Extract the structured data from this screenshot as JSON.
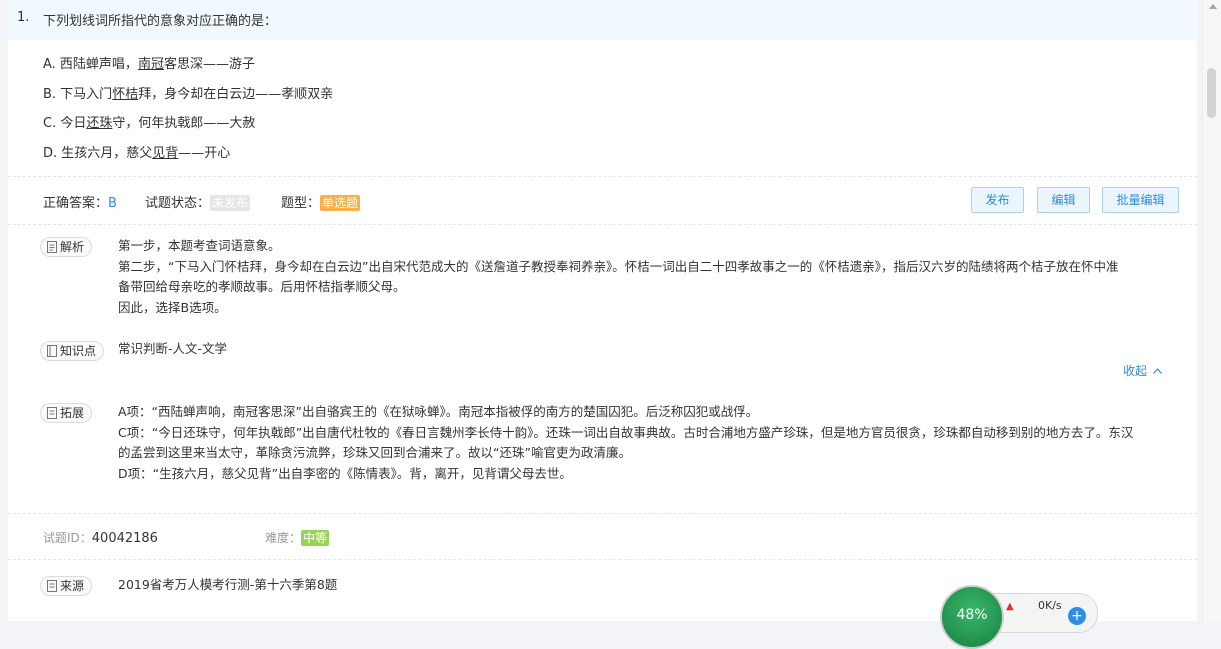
{
  "question": {
    "number": "1.",
    "title": "下列划线词所指代的意象对应正确的是：",
    "options": [
      {
        "prefix": "A.  西陆蝉声唱，",
        "underline": "南冠",
        "suffix": "客思深——游子"
      },
      {
        "prefix": "B.  下马入门",
        "underline": "怀桔",
        "suffix": "拜，身今却在白云边——孝顺双亲"
      },
      {
        "prefix": "C.  今日",
        "underline": "还珠",
        "suffix": "守，何年执戟郎——大赦"
      },
      {
        "prefix": "D.  生孩六月，慈父",
        "underline": "见背",
        "suffix": "——开心"
      }
    ]
  },
  "meta": {
    "answer_label": "正确答案：",
    "answer_value": "B",
    "status_label": "试题状态：",
    "status_value": "未发布",
    "type_label": "题型：",
    "type_value": "单选题"
  },
  "buttons": {
    "publish": "发布",
    "edit": "编辑",
    "batch_edit": "批量编辑"
  },
  "analysis": {
    "label": "解析",
    "lines": [
      "第一步，本题考查词语意象。",
      "第二步，“下马入门怀桔拜，身今却在白云边”出自宋代范成大的《送詹道子教授奉祠养亲》。怀桔一词出自二十四孝故事之一的《怀桔遗亲》，指后汉六岁的陆绩将两个桔子放在怀中准",
      "备带回给母亲吃的孝顺故事。后用怀桔指孝顺父母。",
      "因此，选择B选项。"
    ]
  },
  "knowledge": {
    "label": "知识点",
    "value": "常识判断-人文-文学"
  },
  "collapse_label": "收起",
  "extension": {
    "label": "拓展",
    "lines": [
      "A项：“西陆蝉声响，南冠客思深”出自骆宾王的《在狱咏蝉》。南冠本指被俘的南方的楚国囚犯。后泛称囚犯或战俘。",
      "C项：“今日还珠守，何年执戟郎”出自唐代杜牧的《春日言魏州李长侍十韵》。还珠一词出自故事典故。古时合浦地方盛产珍珠，但是地方官员很贪，珍珠都自动移到别的地方去了。东汉",
      "的孟尝到这里来当太守，革除贪污流弊，珍珠又回到合浦来了。故以“还珠”喻官吏为政清廉。",
      "D项：“生孩六月，慈父见背”出自李密的《陈情表》。背，离开，见背谓父母去世。"
    ]
  },
  "info": {
    "id_label": "试题ID：",
    "id_value": "40042186",
    "difficulty_label": "难度：",
    "difficulty_value": "中等"
  },
  "source": {
    "label": "来源",
    "value": "2019省考万人模考行测-第十六季第8题"
  },
  "net_widget": {
    "percent": "48%",
    "speed": "0K/s"
  }
}
